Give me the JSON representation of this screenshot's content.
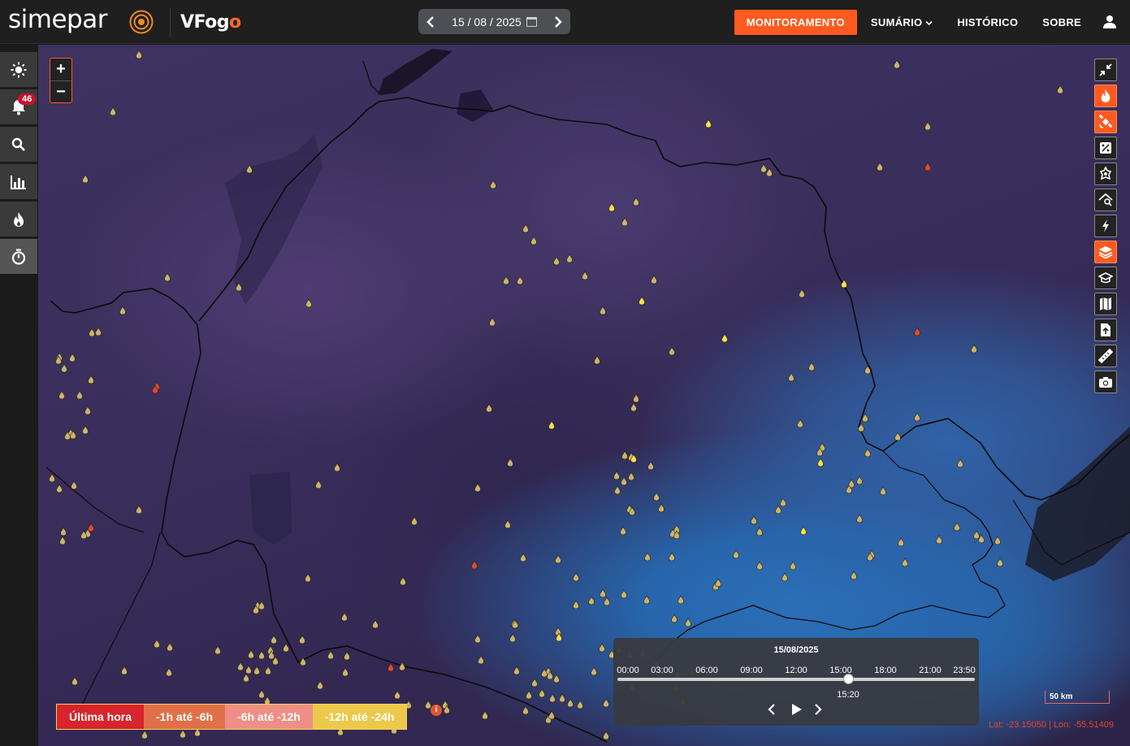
{
  "header": {
    "brand": "simepar",
    "product_prefix": "VFog",
    "product_suffix": "o",
    "date": "15 / 08 / 2025",
    "nav": [
      {
        "label": "MONITORAMENTO",
        "active": true
      },
      {
        "label": "SUMÁRIO",
        "dropdown": true
      },
      {
        "label": "HISTÓRICO"
      },
      {
        "label": "SOBRE"
      }
    ]
  },
  "sidebar": {
    "items": [
      {
        "icon": "sun-icon"
      },
      {
        "icon": "bell-icon",
        "badge": "46"
      },
      {
        "icon": "search-icon"
      },
      {
        "icon": "bar-chart-icon"
      },
      {
        "icon": "fire-icon"
      },
      {
        "icon": "stopwatch-icon",
        "active": true
      }
    ]
  },
  "zoom": {
    "in": "+",
    "out": "−"
  },
  "right_tools": [
    {
      "icon": "collapse-arrows-icon",
      "on": false
    },
    {
      "icon": "fire-layer-icon",
      "on": true
    },
    {
      "icon": "satellite-icon",
      "on": true
    },
    {
      "icon": "percent-icon",
      "on": false
    },
    {
      "icon": "hazard-icon",
      "on": false
    },
    {
      "icon": "search-house-icon",
      "on": false
    },
    {
      "icon": "lightning-icon",
      "on": false
    },
    {
      "icon": "layers-icon",
      "on": true
    },
    {
      "icon": "graduation-cap-icon",
      "on": false
    },
    {
      "icon": "map-icon",
      "on": false
    },
    {
      "icon": "upload-file-icon",
      "on": false
    },
    {
      "icon": "ruler-icon",
      "on": false
    },
    {
      "icon": "camera-icon",
      "on": false
    }
  ],
  "legend": [
    {
      "label": "Última hora",
      "color": "#d8242c"
    },
    {
      "label": "-1h até -6h",
      "color": "#e0704a"
    },
    {
      "label": "-6h até -12h",
      "color": "#ef8e86"
    },
    {
      "label": "-12h até -24h",
      "color": "#ecc94a"
    }
  ],
  "timeline": {
    "date": "15/08/2025",
    "ticks": [
      "00:00",
      "03:00",
      "06:00",
      "09:00",
      "12:00",
      "15:00",
      "18:00",
      "21:00",
      "23:50"
    ],
    "current": "15:20",
    "position": 0.6454
  },
  "scale_label": "50 km",
  "coords": {
    "lat": "Lat: -23.15050",
    "lon": "Lon: -55.51409"
  },
  "colors": {
    "accent": "#ff5a1f",
    "fire_yellow": "#f4e04d",
    "fire_dim": "#c8b45a",
    "fire_red": "#e04a2a"
  }
}
